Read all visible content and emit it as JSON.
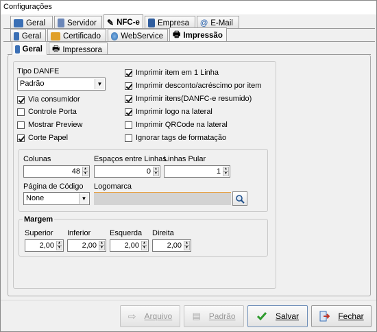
{
  "window": {
    "title": "Configurações"
  },
  "tabs_top": [
    "Geral",
    "Servidor",
    "NFC-e",
    "Empresa",
    "E-Mail"
  ],
  "tabs_mid": [
    "Geral",
    "Certificado",
    "WebService",
    "Impressão"
  ],
  "tabs_inner": [
    "Geral",
    "Impressora"
  ],
  "tipo_danfe": {
    "label": "Tipo DANFE",
    "value": "Padrão"
  },
  "left_checks": [
    {
      "label": "Via consumidor",
      "checked": true
    },
    {
      "label": "Controle Porta",
      "checked": false
    },
    {
      "label": "Mostrar Preview",
      "checked": false
    },
    {
      "label": "Corte Papel",
      "checked": true
    }
  ],
  "right_checks": [
    {
      "label": "Imprimir item em 1 Linha",
      "checked": true
    },
    {
      "label": "Imprimir desconto/acréscimo por item",
      "checked": true
    },
    {
      "label": "Imprimir itens(DANFC-e resumido)",
      "checked": true
    },
    {
      "label": "Imprimir logo na lateral",
      "checked": true
    },
    {
      "label": "Imprimir QRCode na lateral",
      "checked": false
    },
    {
      "label": "Ignorar tags de formatação",
      "checked": false
    }
  ],
  "fields": {
    "colunas": {
      "label": "Colunas",
      "value": "48"
    },
    "espacos": {
      "label": "Espaços entre Linhas",
      "value": "0"
    },
    "linhas": {
      "label": "Linhas Pular",
      "value": "1"
    },
    "pagina": {
      "label": "Página de Código",
      "value": "None"
    },
    "logomarca": {
      "label": "Logomarca",
      "value": ""
    }
  },
  "margem": {
    "title": "Margem",
    "items": [
      {
        "label": "Superior",
        "value": "2,00"
      },
      {
        "label": "Inferior",
        "value": "2,00"
      },
      {
        "label": "Esquerda",
        "value": "2,00"
      },
      {
        "label": "Direita",
        "value": "2,00"
      }
    ]
  },
  "buttons": {
    "arquivo": "Arquivo",
    "padrao": "Padrão",
    "salvar": "Salvar",
    "fechar": "Fechar"
  },
  "colors": {
    "check_green": "#2e9b2e",
    "door_red": "#c0392b",
    "blue_icon": "#3a6fb5"
  }
}
